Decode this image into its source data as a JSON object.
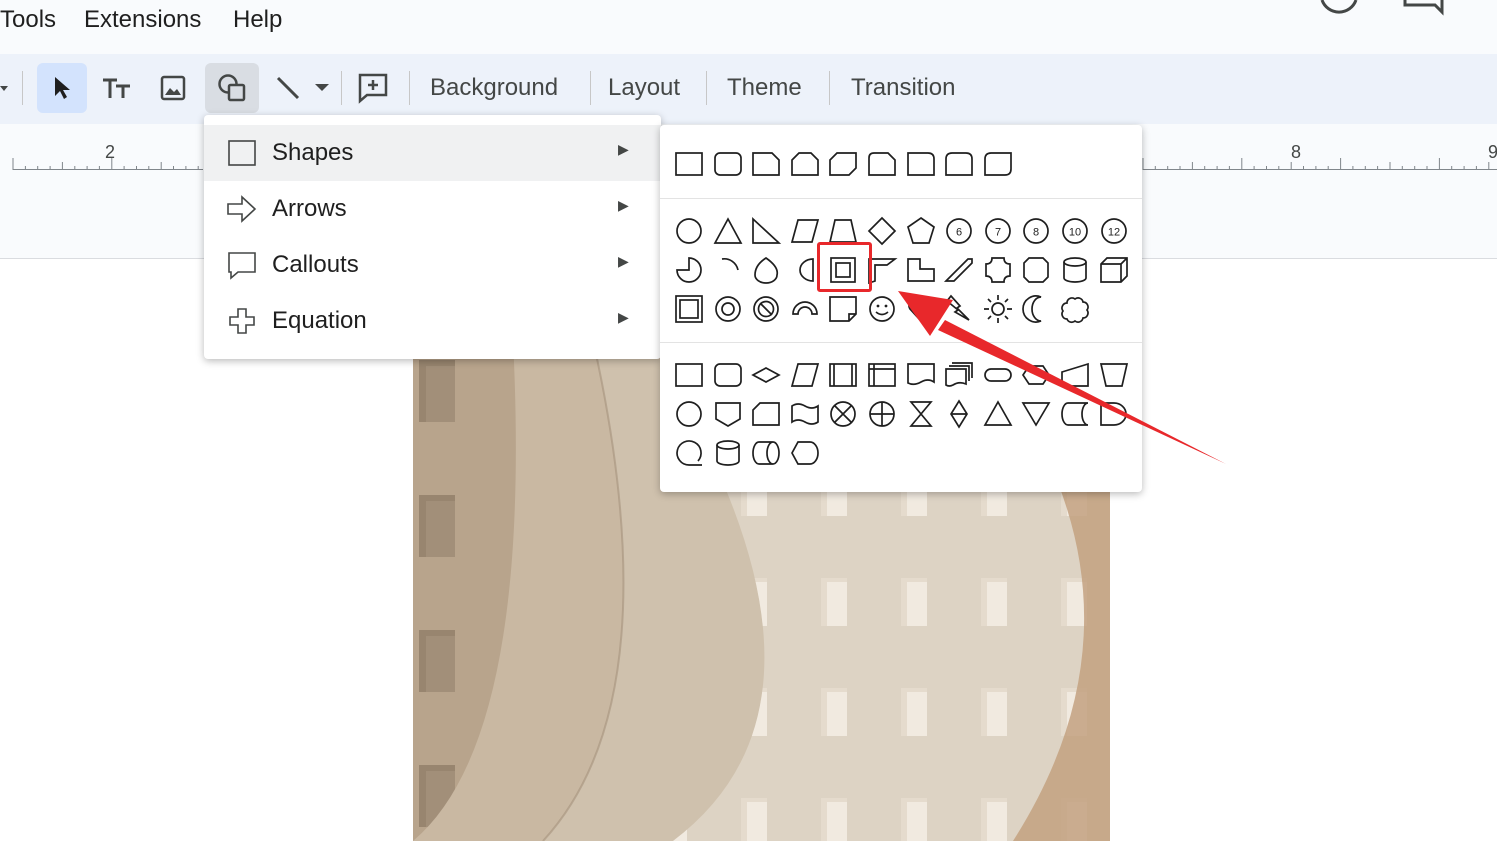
{
  "menubar": {
    "items": [
      "Tools",
      "Extensions",
      "Help"
    ]
  },
  "toolbar": {
    "tools": [
      "select-tool",
      "text-box-tool",
      "image-tool",
      "shape-tool",
      "line-tool",
      "line-dropdown",
      "new-comment-tool"
    ],
    "background_label": "Background",
    "layout_label": "Layout",
    "theme_label": "Theme",
    "transition_label": "Transition"
  },
  "ruler": {
    "labels": [
      "2",
      "8",
      "9"
    ]
  },
  "insert_menu": {
    "items": [
      {
        "label": "Shapes",
        "icon": "square-icon",
        "submenu_arrow": "▶",
        "highlighted": true
      },
      {
        "label": "Arrows",
        "icon": "right-arrow-icon",
        "submenu_arrow": "▶",
        "highlighted": false
      },
      {
        "label": "Callouts",
        "icon": "callout-icon",
        "submenu_arrow": "▶",
        "highlighted": false
      },
      {
        "label": "Equation",
        "icon": "plus-icon",
        "submenu_arrow": "▶",
        "highlighted": false
      }
    ]
  },
  "shapes_panel": {
    "rectangles": [
      "rectangle",
      "rounded-rectangle",
      "snip-one-corner",
      "snip-same-side",
      "snip-diagonal",
      "snip-round-one",
      "round-one-corner",
      "round-same-side",
      "round-diagonal"
    ],
    "basic_shapes": {
      "number_badges": [
        "6",
        "7",
        "8",
        "10",
        "12"
      ],
      "highlighted_shape": "frame"
    },
    "flowchart": [
      "process",
      "alternate-process",
      "decision",
      "data",
      "predefined-process",
      "internal-storage",
      "document",
      "multidocument",
      "terminator",
      "preparation",
      "manual-input",
      "manual-operation",
      "connector",
      "off-page-connector",
      "card",
      "punched-tape",
      "summing-junction",
      "or",
      "collate",
      "sort",
      "extract",
      "merge",
      "stored-data",
      "delay",
      "sequential-access-storage",
      "magnetic-disk",
      "direct-access-storage",
      "display"
    ]
  },
  "colors": {
    "highlight_box": "#e8282b",
    "annotation_arrow": "#e8282b",
    "toolbar_bg": "#edf2fa",
    "selected_tool_bg": "#d3e3fd"
  }
}
